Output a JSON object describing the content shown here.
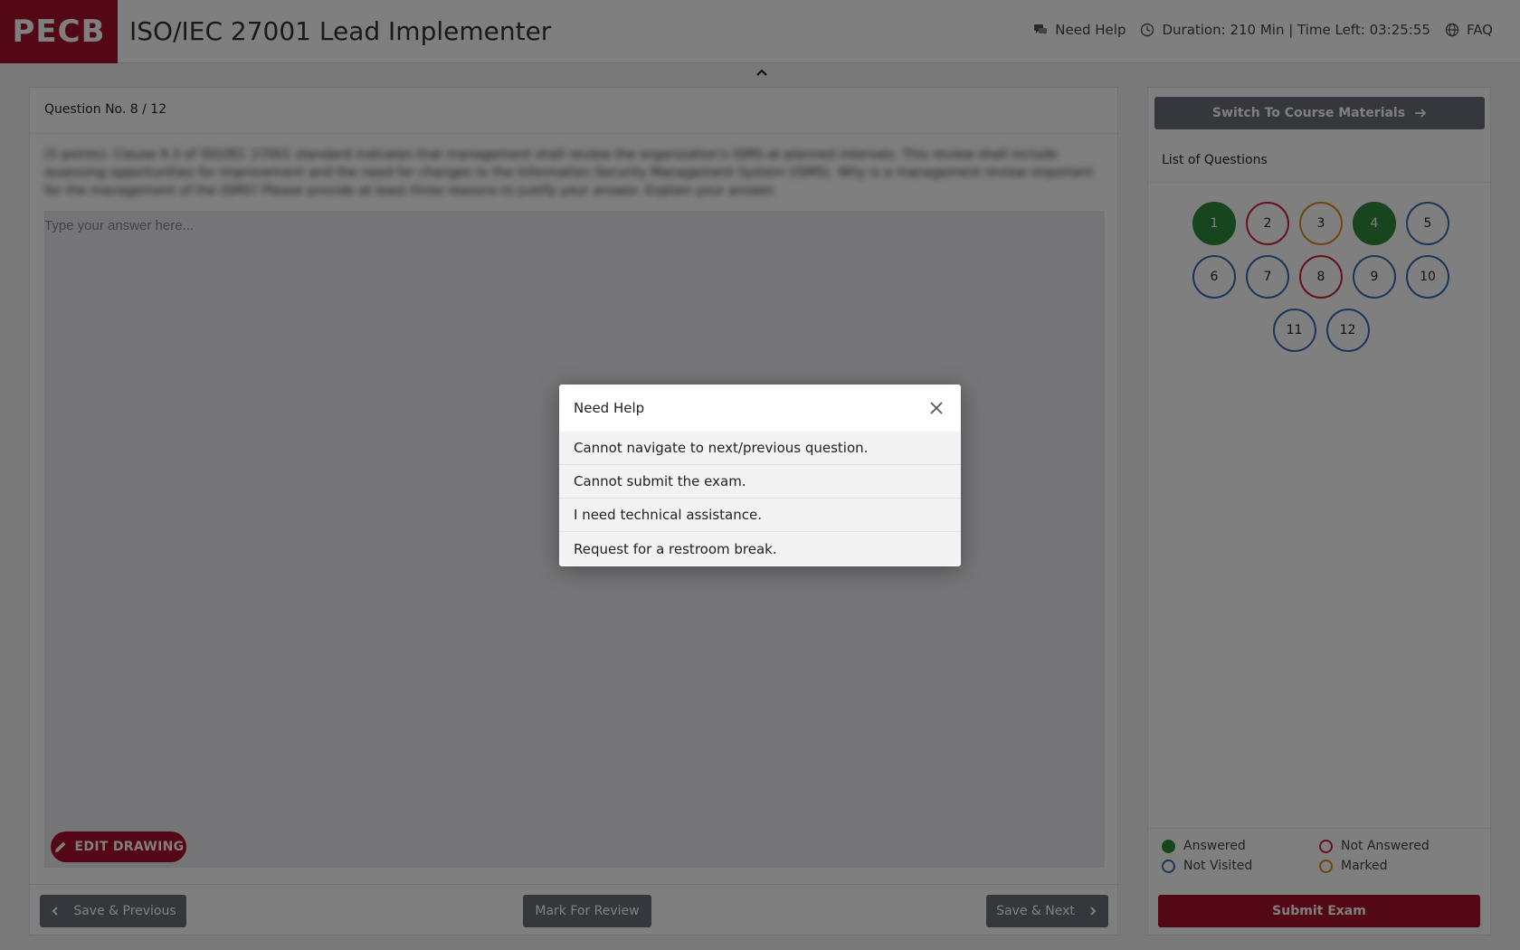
{
  "header": {
    "logo": "PECB",
    "title": "ISO/IEC 27001 Lead Implementer",
    "need_help": "Need Help",
    "duration": "Duration: 210 Min | Time Left: 03:25:55",
    "faq": "FAQ"
  },
  "question": {
    "number_label": "Question No. 8 / 12",
    "text": "(5 points): Clause 9.3 of ISO/IEC 27001 standard indicates that management shall review the organization's ISMS at planned intervals. This review shall include assessing opportunities for improvement and the need for changes to the Information Security Management System (ISMS). Why is a management review important for the management of the ISMS? Please provide at least three reasons to justify your answer. Explain your answer.",
    "answer_placeholder": "Type your answer here...",
    "answer_value": ""
  },
  "toolbar": {
    "edit_drawing": "EDIT DRAWING",
    "save_previous": "Save & Previous",
    "mark_review": "Mark For Review",
    "save_next": "Save & Next"
  },
  "sidebar": {
    "switch_label": "Switch To Course Materials",
    "list_title": "List of Questions",
    "questions": [
      {
        "label": "1",
        "status": "answered"
      },
      {
        "label": "2",
        "status": "not-answered"
      },
      {
        "label": "3",
        "status": "marked"
      },
      {
        "label": "4",
        "status": "answered"
      },
      {
        "label": "5",
        "status": "not-visited"
      },
      {
        "label": "6",
        "status": "not-visited"
      },
      {
        "label": "7",
        "status": "not-visited"
      },
      {
        "label": "8",
        "status": "not-answered"
      },
      {
        "label": "9",
        "status": "not-visited"
      },
      {
        "label": "10",
        "status": "not-visited"
      },
      {
        "label": "11",
        "status": "not-visited"
      },
      {
        "label": "12",
        "status": "not-visited"
      }
    ],
    "legend": {
      "answered": "Answered",
      "not_answered": "Not Answered",
      "not_visited": "Not Visited",
      "marked": "Marked"
    },
    "submit_label": "Submit Exam"
  },
  "modal": {
    "title": "Need Help",
    "items": [
      "Cannot navigate to next/previous question.",
      "Cannot submit the exam.",
      "I need technical assistance.",
      "Request for a restroom break."
    ]
  },
  "colors": {
    "brand": "#a8102a",
    "answered": "#2e8b3a",
    "not_answered": "#c8243a",
    "marked": "#e08a1e",
    "not_visited": "#3a6fb5",
    "button_dark": "#6d6f7a"
  },
  "icons": {
    "need_help": "chat-bubbles-icon",
    "duration": "clock-icon",
    "faq": "globe-icon",
    "collapse": "chevron-up-icon",
    "edit_drawing": "pencil-icon",
    "previous": "chevron-left-icon",
    "next": "chevron-right-icon",
    "switch": "arrow-right-icon",
    "modal_close": "close-icon"
  }
}
